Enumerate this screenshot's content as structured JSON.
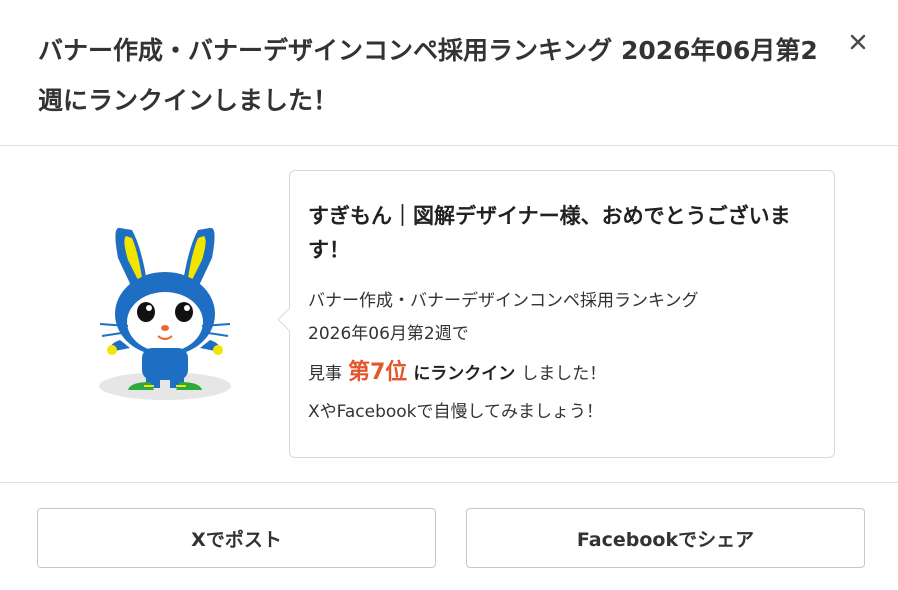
{
  "modal": {
    "title": "バナー作成・バナーデザインコンペ採用ランキング 2026年06月第2週にランクインしました！",
    "close_icon": "close-icon"
  },
  "mascot": {
    "icon": "rabbit-mascot-icon",
    "colors": {
      "body": "#1e6fc4",
      "ear_accent": "#f2e600",
      "face": "#ffffff",
      "shoes": "#2eaa3c",
      "shadow": "#e6e6e6"
    }
  },
  "bubble": {
    "congrats": "すぎもん｜図解デザイナー様、おめでとうございます！",
    "line1": "バナー作成・バナーデザインコンペ採用ランキング",
    "line2": "2026年06月第2週で",
    "prefix": "見事",
    "rank": "第7位",
    "rank_in": "にランクイン",
    "suffix": "しました！",
    "line4": "XやFacebookで自慢してみましょう！",
    "rank_color": "#e2572c"
  },
  "footer": {
    "x_button": "Xでポスト",
    "facebook_button": "Facebookでシェア"
  }
}
